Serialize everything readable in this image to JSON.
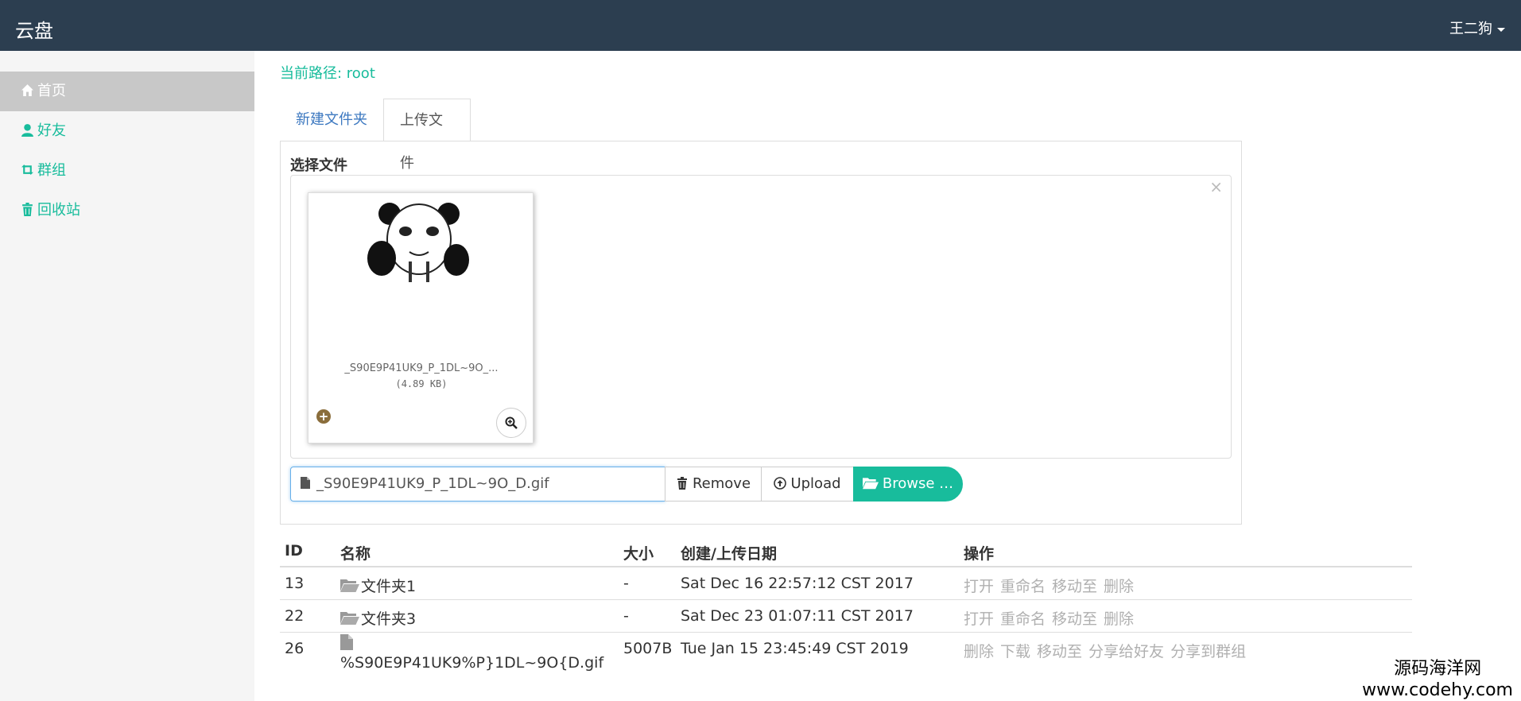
{
  "navbar": {
    "brand": "云盘",
    "user": "王二狗"
  },
  "sidebar": {
    "items": [
      {
        "label": "首页",
        "icon": "home-icon",
        "active": true
      },
      {
        "label": "好友",
        "icon": "user-icon"
      },
      {
        "label": "群组",
        "icon": "retweet-icon"
      },
      {
        "label": "回收站",
        "icon": "trash-icon"
      }
    ]
  },
  "path": {
    "label": "当前路径: root"
  },
  "tabs": [
    {
      "label": "新建文件夹"
    },
    {
      "label": "上传文件",
      "active": true
    }
  ],
  "upload": {
    "title": "选择文件",
    "close": "×",
    "thumb_name": "_S90E9P41UK9_P_1DL~9O_...",
    "thumb_size": "(4.89 KB)",
    "file_value": "_S90E9P41UK9_P_1DL~9O_D.gif",
    "remove_label": "Remove",
    "upload_label": "Upload",
    "browse_label": "Browse …"
  },
  "table": {
    "headers": {
      "id": "ID",
      "name": "名称",
      "size": "大小",
      "date": "创建/上传日期",
      "ops": "操作"
    },
    "rows": [
      {
        "id": "13",
        "name": "文件夹1",
        "type": "folder",
        "size": "-",
        "date": "Sat Dec 16 22:57:12 CST 2017",
        "ops": [
          "打开",
          "重命名",
          "移动至",
          "删除"
        ]
      },
      {
        "id": "22",
        "name": "文件夹3",
        "type": "folder",
        "size": "-",
        "date": "Sat Dec 23 01:07:11 CST 2017",
        "ops": [
          "打开",
          "重命名",
          "移动至",
          "删除"
        ]
      },
      {
        "id": "26",
        "name": "%S90E9P41UK9%P}1DL~9O{D.gif",
        "type": "file",
        "size": "5007B",
        "date": "Tue Jan 15 23:45:49 CST 2019",
        "ops": [
          "删除",
          "下载",
          "移动至",
          "分享给好友",
          "分享到群组"
        ]
      }
    ]
  },
  "watermark": {
    "line1": "源码海洋网",
    "line2": "www.codehy.com"
  },
  "colors": {
    "navbar": "#2c3e50",
    "accent": "#18bc9c",
    "sidebar_active": "#c8c8c8"
  }
}
